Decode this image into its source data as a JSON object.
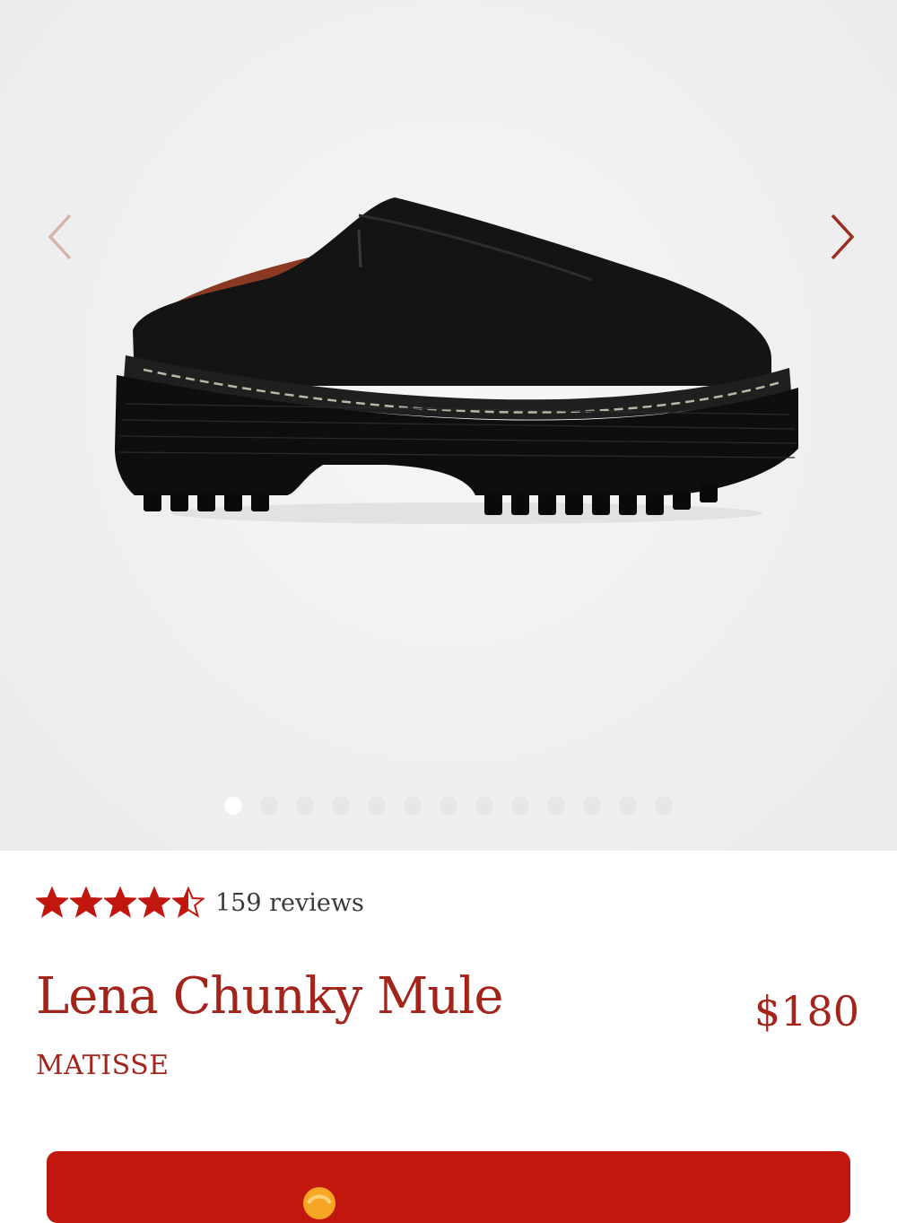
{
  "gallery": {
    "prev_icon": "chevron-left-icon",
    "next_icon": "chevron-right-icon",
    "image_count": 13,
    "active_index": 0
  },
  "product": {
    "rating": 4.5,
    "rating_max": 5,
    "reviews_label": "159 reviews",
    "name": "Lena Chunky Mule",
    "price": "$180",
    "brand": "MATISSE"
  },
  "colors": {
    "accent": "#a3241b",
    "star": "#c2170f",
    "button": "#c2170f",
    "arrow_prev": "#d9b3a8",
    "arrow_next": "#9e2a1e"
  },
  "cta": {
    "icon": "gift-icon"
  }
}
